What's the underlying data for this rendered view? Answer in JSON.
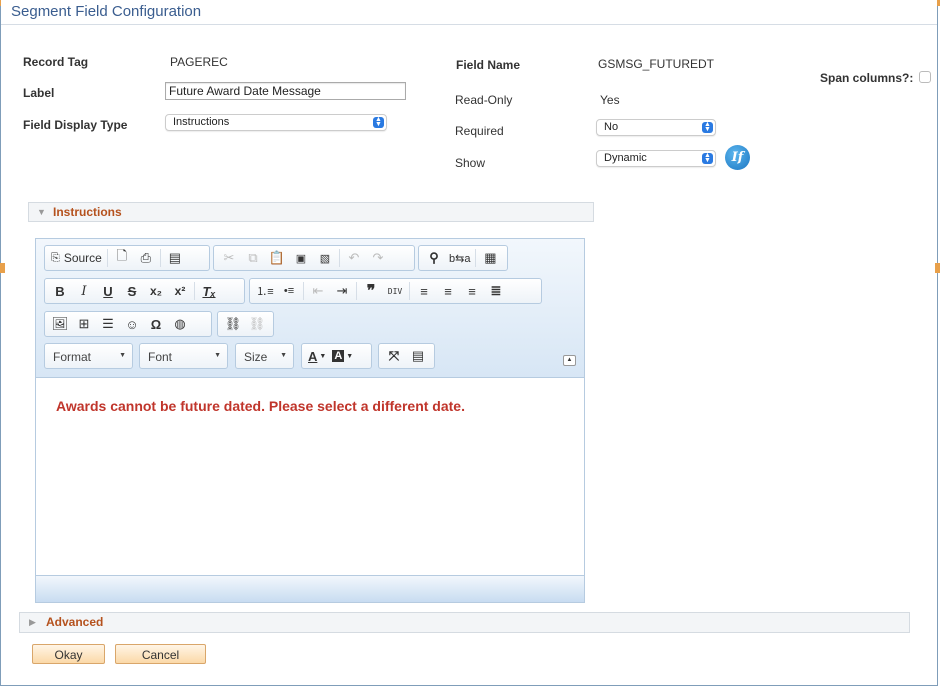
{
  "window": {
    "title": "Segment Field Configuration"
  },
  "form": {
    "record_tag": {
      "label": "Record Tag",
      "value": "PAGEREC"
    },
    "label_field": {
      "label": "Label",
      "value": "Future Award Date Message"
    },
    "field_display_type": {
      "label": "Field Display Type",
      "value": "Instructions"
    },
    "field_name": {
      "label": "Field Name",
      "value": "GSMSG_FUTUREDT"
    },
    "read_only": {
      "label": "Read-Only",
      "value": "Yes"
    },
    "required": {
      "label": "Required",
      "value": "No"
    },
    "show": {
      "label": "Show",
      "value": "Dynamic",
      "condition_icon": "if-condition-icon",
      "condition_icon_text": "If"
    },
    "span_columns": {
      "label": "Span columns?:",
      "checked": false
    }
  },
  "instructions_section": {
    "title": "Instructions",
    "expanded": true
  },
  "editor": {
    "toolbar": {
      "row1": [
        {
          "name": "source",
          "label": "Source",
          "icon": "source-icon"
        },
        {
          "name": "preview",
          "icon": "preview-icon"
        },
        {
          "name": "print",
          "icon": "print-icon"
        },
        {
          "name": "templates",
          "icon": "templates-icon"
        },
        {
          "name": "cut",
          "icon": "cut-icon",
          "disabled": true
        },
        {
          "name": "copy",
          "icon": "copy-icon",
          "disabled": true
        },
        {
          "name": "paste",
          "icon": "paste-icon"
        },
        {
          "name": "paste-text",
          "icon": "paste-text-icon"
        },
        {
          "name": "paste-word",
          "icon": "paste-word-icon"
        },
        {
          "name": "undo",
          "icon": "undo-icon",
          "disabled": true
        },
        {
          "name": "redo",
          "icon": "redo-icon",
          "disabled": true
        },
        {
          "name": "find",
          "icon": "find-icon"
        },
        {
          "name": "replace",
          "icon": "replace-icon"
        },
        {
          "name": "select-all",
          "icon": "select-all-icon"
        }
      ],
      "row2_glyphs": {
        "bold": "B",
        "italic": "I",
        "underline": "U",
        "strike": "S",
        "subscript": "x₂",
        "superscript": "x²",
        "remove_format": "Tₓ",
        "numbered_list": "⒈≡",
        "bulleted_list": "•≡",
        "outdent": "⇤",
        "indent": "⇥",
        "blockquote": "❞",
        "div": "DIV",
        "align_left": "≡",
        "align_center": "≡",
        "align_right": "≡",
        "justify": "≣"
      },
      "combos": {
        "format": "Format",
        "font": "Font",
        "size": "Size"
      },
      "text_color": "A",
      "bg_color": "A"
    },
    "content": "Awards cannot be future dated. Please select a different date.",
    "content_color": "#c0352b"
  },
  "advanced_section": {
    "title": "Advanced",
    "expanded": false
  },
  "buttons": {
    "okay": "Okay",
    "cancel": "Cancel"
  }
}
